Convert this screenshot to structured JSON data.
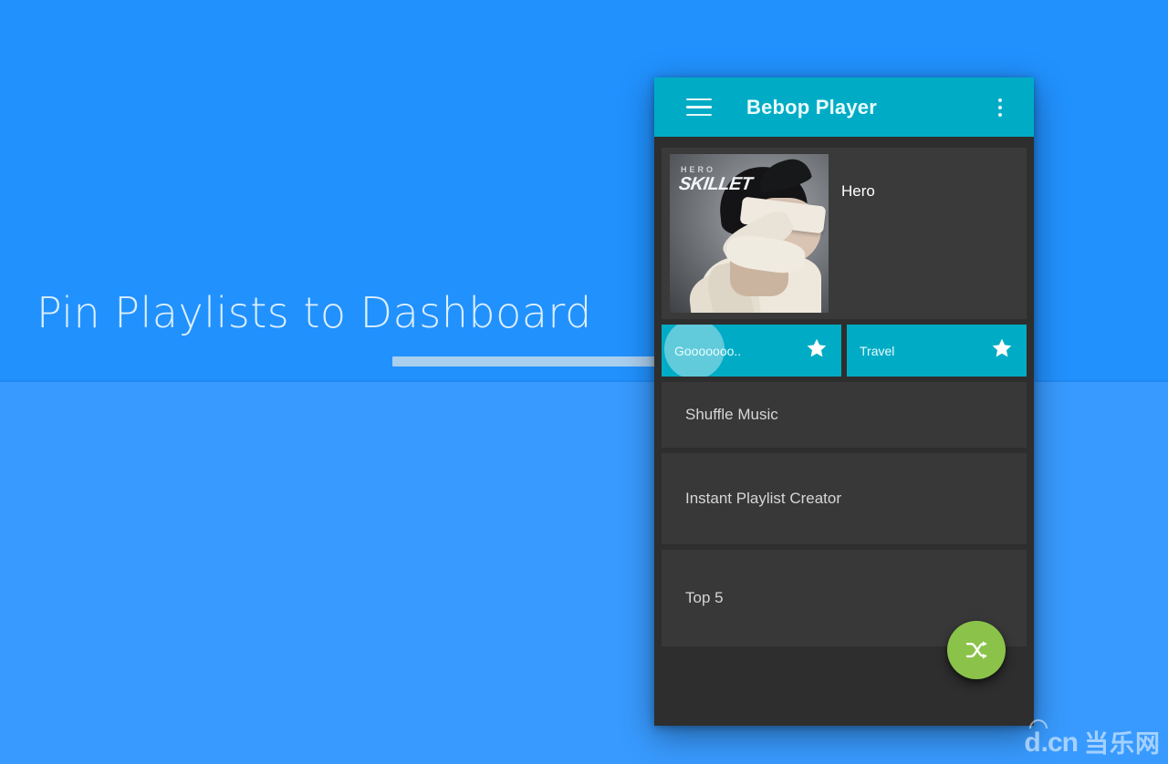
{
  "headline": "Pin Playlists to Dashboard",
  "colors": {
    "background_top": "#2191fe",
    "background_bottom": "#389afe",
    "accent_teal": "#00acc5",
    "card_dark": "#383838",
    "panel_dark": "#2e2e2e",
    "fab_green": "#8bc34a",
    "pointer_bar": "#a9cfee"
  },
  "appbar": {
    "title": "Bebop Player",
    "menu_icon": "hamburger-menu-icon",
    "overflow_icon": "overflow-menu-icon"
  },
  "now_playing": {
    "track_title": "Hero",
    "album_art": {
      "artist": "SKILLET",
      "album": "HERO",
      "alt": "album-art-hero-skillet"
    }
  },
  "pinned_playlists": [
    {
      "label": "Gooooooo..",
      "star_icon": "star-icon",
      "pressed": true
    },
    {
      "label": "Travel",
      "star_icon": "star-icon",
      "pressed": false
    }
  ],
  "list_items": [
    {
      "label": "Shuffle Music",
      "name": "shuffle-music"
    },
    {
      "label": "Instant Playlist Creator",
      "name": "instant-playlist-creator"
    },
    {
      "label": "Top 5",
      "name": "top-5"
    }
  ],
  "fab": {
    "icon": "shuffle-icon",
    "label": "Shuffle"
  },
  "watermark": {
    "d": "d",
    "cn": ".cn",
    "zh": "当乐网"
  }
}
